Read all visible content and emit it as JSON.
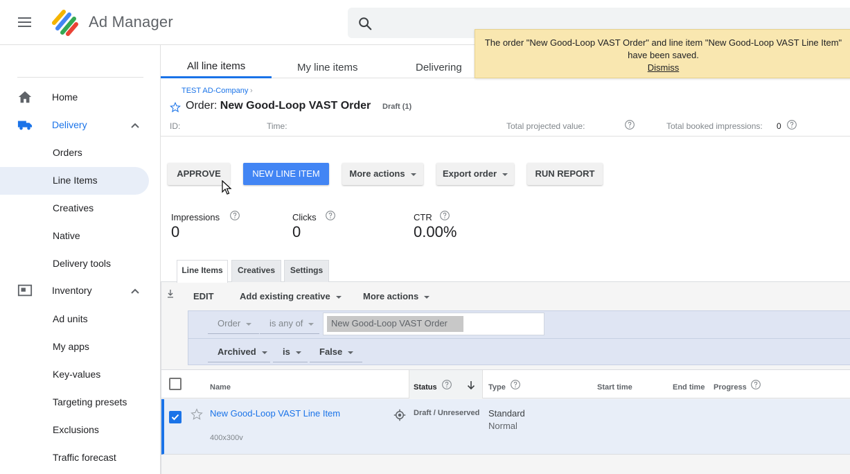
{
  "app": {
    "title": "Ad Manager"
  },
  "sidebar": {
    "items": [
      {
        "label": "Home"
      },
      {
        "label": "Delivery"
      },
      {
        "label": "Orders"
      },
      {
        "label": "Line Items"
      },
      {
        "label": "Creatives"
      },
      {
        "label": "Native"
      },
      {
        "label": "Delivery tools"
      },
      {
        "label": "Inventory"
      },
      {
        "label": "Ad units"
      },
      {
        "label": "My apps"
      },
      {
        "label": "Key-values"
      },
      {
        "label": "Targeting presets"
      },
      {
        "label": "Exclusions"
      },
      {
        "label": "Traffic forecast"
      }
    ]
  },
  "tabs": [
    {
      "label": "All line items"
    },
    {
      "label": "My line items"
    },
    {
      "label": "Delivering"
    }
  ],
  "toast": {
    "line1": "The order \"New Good-Loop VAST Order\" and line item \"New Good-Loop VAST Line Item\"",
    "line2": "have been saved.",
    "dismiss": "Dismiss"
  },
  "order": {
    "breadcrumb": "TEST AD-Company",
    "breadcrumb_sep": "›",
    "prefix": "Order: ",
    "name": "New Good-Loop VAST Order",
    "badge": "Draft (1)",
    "id_label": "ID:",
    "time_label": "Time:",
    "projected_label": "Total projected value:",
    "booked_label": "Total booked impressions:",
    "booked_value": "0"
  },
  "actions": {
    "approve": "APPROVE",
    "new_line_item": "NEW LINE ITEM",
    "more_actions": "More actions",
    "export_order": "Export order",
    "run_report": "RUN REPORT"
  },
  "stats": [
    {
      "label": "Impressions",
      "value": "0"
    },
    {
      "label": "Clicks",
      "value": "0"
    },
    {
      "label": "CTR",
      "value": "0.00%"
    }
  ],
  "subtabs": [
    {
      "label": "Line Items"
    },
    {
      "label": "Creatives"
    },
    {
      "label": "Settings"
    }
  ],
  "toolbar": {
    "edit": "EDIT",
    "add_existing_creative": "Add existing creative",
    "more_actions": "More actions"
  },
  "filters": {
    "row1": {
      "field": "Order",
      "op": "is any of",
      "chip": "New Good-Loop VAST Order"
    },
    "row2": {
      "field": "Archived",
      "op": "is",
      "value": "False"
    }
  },
  "table": {
    "headers": {
      "name": "Name",
      "status": "Status",
      "type": "Type",
      "start": "Start time",
      "end": "End time",
      "progress": "Progress"
    },
    "rows": [
      {
        "name": "New Good-Loop VAST Line Item",
        "size": "400x300v",
        "status": "Draft / Unreserved",
        "type": "Standard",
        "priority": "Normal",
        "selected": true
      }
    ]
  }
}
